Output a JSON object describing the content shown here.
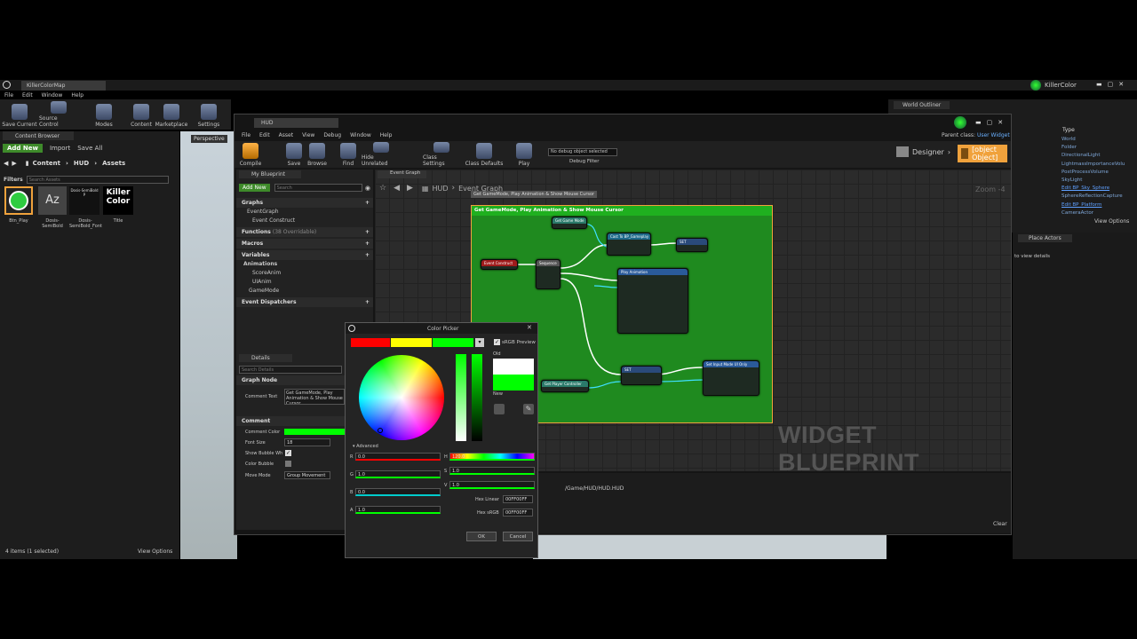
{
  "main_window": {
    "tab": "KillerColorMap",
    "menu": [
      "File",
      "Edit",
      "Window",
      "Help"
    ],
    "user": "KillerColor",
    "toolbar": [
      {
        "label": "Save Current",
        "icon": "save-icon"
      },
      {
        "label": "Source Control",
        "icon": "source-control-icon"
      },
      {
        "label": "Modes",
        "icon": "modes-icon"
      },
      {
        "label": "Content",
        "icon": "content-icon"
      },
      {
        "label": "Marketplace",
        "icon": "marketplace-icon"
      },
      {
        "label": "Settings",
        "icon": "settings-icon"
      }
    ]
  },
  "content_browser": {
    "tab": "Content Browser",
    "add_new": "Add New",
    "import": "Import",
    "save_all": "Save All",
    "path": [
      "Content",
      "HUD",
      "Assets"
    ],
    "filters": "Filters",
    "search_placeholder": "Search Assets",
    "assets": [
      {
        "label": "Btn_Play",
        "thumb": ""
      },
      {
        "label": "Dosis-SemiBold",
        "thumb": "Az"
      },
      {
        "label": "Dosis-SemiBold_Font",
        "thumb": "Dosis-SemiBold P"
      },
      {
        "label": "Title",
        "thumb": "Killer Color"
      }
    ],
    "status": "4 items (1 selected)",
    "view_options": "View Options"
  },
  "viewport": {
    "label": "Perspective"
  },
  "world_outliner": {
    "tab": "World Outliner",
    "type_header": "Type",
    "items": [
      "World",
      "Folder",
      "DirectionalLight",
      "LightmassImportanceVolu",
      "PostProcessVolume",
      "SkyLight",
      "Edit BP_Sky_Sphere",
      "SphereReflectionCapture",
      "Edit BP_Platform",
      "CameraActor"
    ],
    "view_options": "View Options"
  },
  "place_actors": {
    "tab": "Place Actors",
    "hint": "to view details"
  },
  "blueprint": {
    "tab": "HUD",
    "menu": [
      "File",
      "Edit",
      "Asset",
      "View",
      "Debug",
      "Window",
      "Help"
    ],
    "parent_class_label": "Parent class:",
    "parent_class": "User Widget",
    "toolbar": [
      {
        "label": "Compile",
        "icon": "compile-icon"
      },
      {
        "label": "Save",
        "icon": "save-icon"
      },
      {
        "label": "Browse",
        "icon": "browse-icon"
      },
      {
        "label": "Find",
        "icon": "find-icon"
      },
      {
        "label": "Hide Unrelated",
        "icon": "hide-unrelated-icon"
      },
      {
        "label": "Class Settings",
        "icon": "class-settings-icon"
      },
      {
        "label": "Class Defaults",
        "icon": "class-defaults-icon"
      },
      {
        "label": "Play",
        "icon": "play-icon"
      }
    ],
    "debug_select": "No debug object selected",
    "debug_filter": "Debug Filter",
    "designer": "Designer",
    "graph": {
      "tab": "Event Graph",
      "breadcrumb_root": "HUD",
      "breadcrumb": "Event Graph",
      "zoom": "Zoom -4",
      "tooltip": "Get GameMode, Play Animation & Show Mouse Cursor",
      "comment_title": "Get GameMode, Play Animation & Show Mouse Cursor",
      "watermark": "WIDGET BLUEPRINT",
      "nodes": [
        "Get Game Mode",
        "Event Construct",
        "Sequence",
        "Cast To BP_Gameplay",
        "SET",
        "Play Animation",
        "Get Player Controller",
        "SET",
        "Set Input Mode UI Only"
      ]
    },
    "my_blueprint": {
      "tab": "My Blueprint",
      "add_new": "Add New",
      "search_placeholder": "Search",
      "graphs_header": "Graphs",
      "event_graph": "EventGraph",
      "event_construct": "Event Construct",
      "functions": "Functions",
      "functions_count": "(38 Overridable)",
      "macros": "Macros",
      "variables": "Variables",
      "animations": "Animations",
      "anims": [
        "ScoreAnim",
        "UIAnim"
      ],
      "game_mode": "GameMode",
      "event_dispatchers": "Event Dispatchers"
    },
    "details": {
      "tab": "Details",
      "search_placeholder": "Search Details",
      "graph_node": "Graph Node",
      "comment_text_label": "Comment Text",
      "comment_text": "Get GameMode, Play Animation & Show Mouse Cursor",
      "comment": "Comment",
      "comment_color": "Comment Color",
      "font_size_label": "Font Size",
      "font_size": "18",
      "show_bubble": "Show Bubble Wh",
      "color_bubble": "Color Bubble",
      "move_mode_label": "Move Mode",
      "move_mode": "Group Movement"
    },
    "compiler": {
      "path": "/Game/HUD/HUD.HUD",
      "clear": "Clear"
    }
  },
  "color_picker": {
    "title": "Color Picker",
    "srgb_preview": "sRGB Preview",
    "old": "Old",
    "new": "New",
    "advanced": "Advanced",
    "theme_colors": [
      "#ff0000",
      "#ffff00",
      "#00ff00"
    ],
    "old_color": "#ffffff",
    "new_color": "#00ff00",
    "channels": [
      {
        "label": "R",
        "value": "0.0"
      },
      {
        "label": "G",
        "value": "1.0"
      },
      {
        "label": "B",
        "value": "0.0"
      },
      {
        "label": "A",
        "value": "1.0"
      }
    ],
    "hsv": [
      {
        "label": "H",
        "value": "120.0"
      },
      {
        "label": "S",
        "value": "1.0"
      },
      {
        "label": "V",
        "value": "1.0"
      }
    ],
    "hex_linear_label": "Hex Linear",
    "hex_linear": "00FF00FF",
    "hex_srgb_label": "Hex sRGB",
    "hex_srgb": "00FF00FF",
    "ok": "OK",
    "cancel": "Cancel"
  },
  "colors": {
    "comment_green": "#1f8a1f",
    "accent_orange": "#f0a23c",
    "add_green": "#3e8a2a"
  }
}
